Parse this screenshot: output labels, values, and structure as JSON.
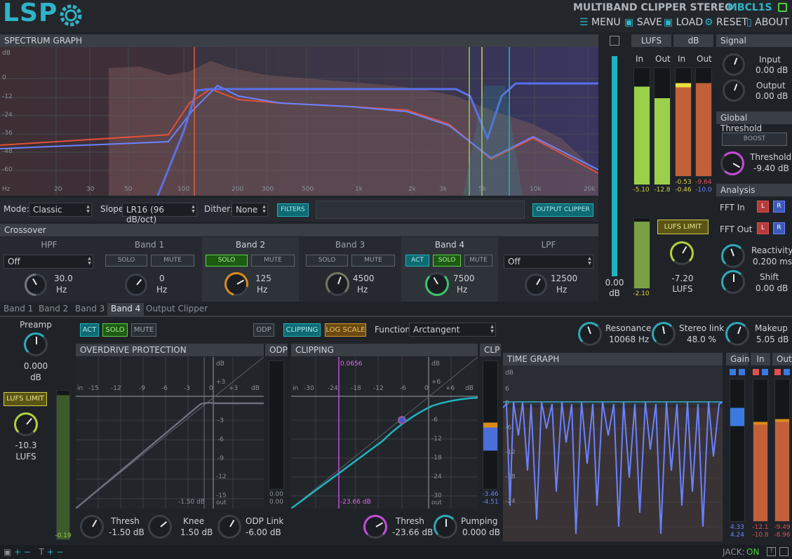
{
  "header": {
    "logo": "LSP",
    "plugin_name": "MULTIBAND CLIPPER STEREO",
    "plugin_id": "MBCL1S",
    "menu": [
      "MENU",
      "SAVE",
      "LOAD",
      "RESET",
      "ABOUT"
    ]
  },
  "spectrum": {
    "title": "SPECTRUM GRAPH",
    "db_labels": [
      "dB",
      "0",
      "-12",
      "-24",
      "-36",
      "-48",
      "-60"
    ],
    "freq_labels": [
      "Hz",
      "20",
      "30",
      "50",
      "100",
      "200",
      "300",
      "500",
      "1k",
      "2k",
      "3k",
      "5k",
      "10k",
      "20k"
    ]
  },
  "controls": {
    "mode_label": "Mode:",
    "mode": "Classic",
    "slope_label": "Slope",
    "slope": "LR16 (96 dB/oct)",
    "dither_label": "Dither:",
    "dither": "None",
    "filters": "FILTERS",
    "output_clipper": "OUTPUT CLIPPER"
  },
  "crossover": {
    "title": "Crossover",
    "hpf": {
      "label": "HPF",
      "select": "Off",
      "value": "30.0",
      "unit": "Hz"
    },
    "band1": {
      "label": "Band 1",
      "solo": "SOLO",
      "mute": "MUTE",
      "value": "0",
      "unit": "Hz"
    },
    "band2": {
      "label": "Band 2",
      "solo": "SOLO",
      "mute": "MUTE",
      "value": "125",
      "unit": "Hz"
    },
    "band3": {
      "label": "Band 3",
      "solo": "SOLO",
      "mute": "MUTE",
      "value": "4500",
      "unit": "Hz"
    },
    "band4": {
      "label": "Band 4",
      "act": "ACT",
      "solo": "SOLO",
      "mute": "MUTE",
      "value": "7500",
      "unit": "Hz"
    },
    "lpf": {
      "label": "LPF",
      "select": "Off",
      "value": "12500",
      "unit": "Hz"
    }
  },
  "tabs": [
    "Band 1",
    "Band 2",
    "Band 3",
    "Band 4",
    "Output Clipper"
  ],
  "master_meter": {
    "value": "0.00",
    "unit": "dB"
  },
  "lufs": {
    "title": "LUFS",
    "in": "In",
    "out": "Out",
    "in_val": "-5.10",
    "out_val": "-12.8",
    "limit": "LUFS LIMIT",
    "knob_val": "-7.20",
    "knob_unit": "LUFS",
    "small_val": "-2.10"
  },
  "db": {
    "title": "dB",
    "in": "In",
    "out": "Out",
    "in_a": "-0.53",
    "in_b": "-0.46",
    "out_a": "-9.64",
    "out_b": "-10.0"
  },
  "signal": {
    "title": "Signal",
    "input_label": "Input",
    "input_val": "0.00 dB",
    "output_label": "Output",
    "output_val": "0.00 dB"
  },
  "global_threshold": {
    "title": "Global Threshold",
    "boost": "BOOST",
    "label": "Threshold",
    "value": "-9.40 dB"
  },
  "analysis": {
    "title": "Analysis",
    "fft_in": "FFT In",
    "fft_out": "FFT Out",
    "l": "L",
    "r": "R",
    "reactivity_label": "Reactivity",
    "reactivity_val": "0.200 ms",
    "shift_label": "Shift",
    "shift_val": "0.00 dB"
  },
  "band": {
    "preamp_label": "Preamp",
    "preamp_val": "0.000",
    "preamp_unit": "dB",
    "lufs_limit": "LUFS LIMIT",
    "lufs_val": "-10.3",
    "lufs_unit": "LUFS",
    "meter_val": "-0.19",
    "act": "ACT",
    "solo": "SOLO",
    "mute": "MUTE",
    "odp": "ODP",
    "clipping": "CLIPPING",
    "log_scale": "LOG SCALE",
    "function_label": "Function",
    "function": "Arctangent",
    "resonance_label": "Resonance",
    "resonance_val": "10068 Hz",
    "stereo_link_label": "Stereo link",
    "stereo_link_val": "48.0 %",
    "makeup_label": "Makeup",
    "makeup_val": "5.05 dB"
  },
  "odp": {
    "title": "OVERDRIVE PROTECTION",
    "meter_title": "ODP",
    "x_ticks": [
      "in",
      "-15",
      "-12",
      "-9",
      "-6",
      "-3",
      "0",
      "+3",
      "dB"
    ],
    "y_ticks": [
      "dB",
      "+3",
      "0",
      "-3",
      "-6",
      "-9",
      "-12",
      "-15",
      "out"
    ],
    "marker": "-1.50 dB",
    "meter_a": "0.00",
    "meter_b": "0.00",
    "thresh_label": "Thresh",
    "thresh_val": "-1.50 dB",
    "knee_label": "Knee",
    "knee_val": "1.50 dB",
    "link_label": "ODP Link",
    "link_val": "-6.00 dB"
  },
  "clip": {
    "title": "CLIPPING",
    "meter_title": "CLP",
    "x_ticks": [
      "in",
      "-30",
      "-24",
      "-18",
      "-12",
      "-6",
      "0",
      "+6",
      "dB"
    ],
    "y_ticks": [
      "dB",
      "+6",
      "0",
      "-6",
      "-12",
      "-18",
      "-24",
      "-30",
      "out"
    ],
    "top_marker": "0.0656",
    "marker": "-23.66 dB",
    "meter_a": "-3.46",
    "meter_b": "-4.51",
    "thresh_label": "Thresh",
    "thresh_val": "-23.66 dB",
    "pumping_label": "Pumping",
    "pumping_val": "0.000 dB"
  },
  "time_graph": {
    "title": "TIME GRAPH",
    "y_ticks": [
      "dB",
      "6",
      "0",
      "-6",
      "-12",
      "-18",
      "-24"
    ]
  },
  "gain_meters": {
    "gain": "Gain",
    "in": "In",
    "out": "Out",
    "gain_a": "4.33",
    "gain_b": "4.24",
    "in_a": "-12.1",
    "in_b": "-10.8",
    "out_a": "-9.49",
    "out_b": "-8.96"
  },
  "status": {
    "jack_label": "JACK:",
    "jack_state": "ON"
  }
}
